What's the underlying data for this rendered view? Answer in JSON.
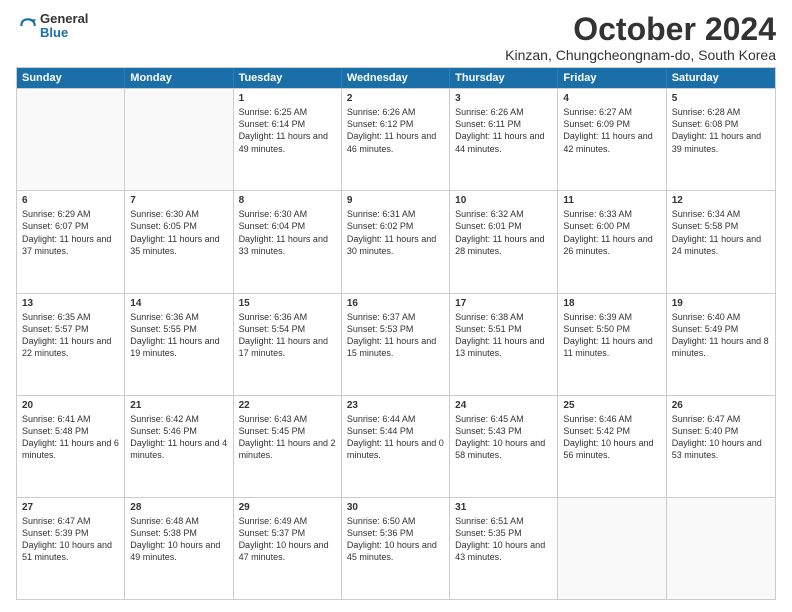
{
  "logo": {
    "general": "General",
    "blue": "Blue"
  },
  "title": "October 2024",
  "subtitle": "Kinzan, Chungcheongnam-do, South Korea",
  "days": [
    "Sunday",
    "Monday",
    "Tuesday",
    "Wednesday",
    "Thursday",
    "Friday",
    "Saturday"
  ],
  "weeks": [
    [
      {
        "day": "",
        "empty": true
      },
      {
        "day": "",
        "empty": true
      },
      {
        "day": "1",
        "sunrise": "Sunrise: 6:25 AM",
        "sunset": "Sunset: 6:14 PM",
        "daylight": "Daylight: 11 hours and 49 minutes."
      },
      {
        "day": "2",
        "sunrise": "Sunrise: 6:26 AM",
        "sunset": "Sunset: 6:12 PM",
        "daylight": "Daylight: 11 hours and 46 minutes."
      },
      {
        "day": "3",
        "sunrise": "Sunrise: 6:26 AM",
        "sunset": "Sunset: 6:11 PM",
        "daylight": "Daylight: 11 hours and 44 minutes."
      },
      {
        "day": "4",
        "sunrise": "Sunrise: 6:27 AM",
        "sunset": "Sunset: 6:09 PM",
        "daylight": "Daylight: 11 hours and 42 minutes."
      },
      {
        "day": "5",
        "sunrise": "Sunrise: 6:28 AM",
        "sunset": "Sunset: 6:08 PM",
        "daylight": "Daylight: 11 hours and 39 minutes."
      }
    ],
    [
      {
        "day": "6",
        "sunrise": "Sunrise: 6:29 AM",
        "sunset": "Sunset: 6:07 PM",
        "daylight": "Daylight: 11 hours and 37 minutes."
      },
      {
        "day": "7",
        "sunrise": "Sunrise: 6:30 AM",
        "sunset": "Sunset: 6:05 PM",
        "daylight": "Daylight: 11 hours and 35 minutes."
      },
      {
        "day": "8",
        "sunrise": "Sunrise: 6:30 AM",
        "sunset": "Sunset: 6:04 PM",
        "daylight": "Daylight: 11 hours and 33 minutes."
      },
      {
        "day": "9",
        "sunrise": "Sunrise: 6:31 AM",
        "sunset": "Sunset: 6:02 PM",
        "daylight": "Daylight: 11 hours and 30 minutes."
      },
      {
        "day": "10",
        "sunrise": "Sunrise: 6:32 AM",
        "sunset": "Sunset: 6:01 PM",
        "daylight": "Daylight: 11 hours and 28 minutes."
      },
      {
        "day": "11",
        "sunrise": "Sunrise: 6:33 AM",
        "sunset": "Sunset: 6:00 PM",
        "daylight": "Daylight: 11 hours and 26 minutes."
      },
      {
        "day": "12",
        "sunrise": "Sunrise: 6:34 AM",
        "sunset": "Sunset: 5:58 PM",
        "daylight": "Daylight: 11 hours and 24 minutes."
      }
    ],
    [
      {
        "day": "13",
        "sunrise": "Sunrise: 6:35 AM",
        "sunset": "Sunset: 5:57 PM",
        "daylight": "Daylight: 11 hours and 22 minutes."
      },
      {
        "day": "14",
        "sunrise": "Sunrise: 6:36 AM",
        "sunset": "Sunset: 5:55 PM",
        "daylight": "Daylight: 11 hours and 19 minutes."
      },
      {
        "day": "15",
        "sunrise": "Sunrise: 6:36 AM",
        "sunset": "Sunset: 5:54 PM",
        "daylight": "Daylight: 11 hours and 17 minutes."
      },
      {
        "day": "16",
        "sunrise": "Sunrise: 6:37 AM",
        "sunset": "Sunset: 5:53 PM",
        "daylight": "Daylight: 11 hours and 15 minutes."
      },
      {
        "day": "17",
        "sunrise": "Sunrise: 6:38 AM",
        "sunset": "Sunset: 5:51 PM",
        "daylight": "Daylight: 11 hours and 13 minutes."
      },
      {
        "day": "18",
        "sunrise": "Sunrise: 6:39 AM",
        "sunset": "Sunset: 5:50 PM",
        "daylight": "Daylight: 11 hours and 11 minutes."
      },
      {
        "day": "19",
        "sunrise": "Sunrise: 6:40 AM",
        "sunset": "Sunset: 5:49 PM",
        "daylight": "Daylight: 11 hours and 8 minutes."
      }
    ],
    [
      {
        "day": "20",
        "sunrise": "Sunrise: 6:41 AM",
        "sunset": "Sunset: 5:48 PM",
        "daylight": "Daylight: 11 hours and 6 minutes."
      },
      {
        "day": "21",
        "sunrise": "Sunrise: 6:42 AM",
        "sunset": "Sunset: 5:46 PM",
        "daylight": "Daylight: 11 hours and 4 minutes."
      },
      {
        "day": "22",
        "sunrise": "Sunrise: 6:43 AM",
        "sunset": "Sunset: 5:45 PM",
        "daylight": "Daylight: 11 hours and 2 minutes."
      },
      {
        "day": "23",
        "sunrise": "Sunrise: 6:44 AM",
        "sunset": "Sunset: 5:44 PM",
        "daylight": "Daylight: 11 hours and 0 minutes."
      },
      {
        "day": "24",
        "sunrise": "Sunrise: 6:45 AM",
        "sunset": "Sunset: 5:43 PM",
        "daylight": "Daylight: 10 hours and 58 minutes."
      },
      {
        "day": "25",
        "sunrise": "Sunrise: 6:46 AM",
        "sunset": "Sunset: 5:42 PM",
        "daylight": "Daylight: 10 hours and 56 minutes."
      },
      {
        "day": "26",
        "sunrise": "Sunrise: 6:47 AM",
        "sunset": "Sunset: 5:40 PM",
        "daylight": "Daylight: 10 hours and 53 minutes."
      }
    ],
    [
      {
        "day": "27",
        "sunrise": "Sunrise: 6:47 AM",
        "sunset": "Sunset: 5:39 PM",
        "daylight": "Daylight: 10 hours and 51 minutes."
      },
      {
        "day": "28",
        "sunrise": "Sunrise: 6:48 AM",
        "sunset": "Sunset: 5:38 PM",
        "daylight": "Daylight: 10 hours and 49 minutes."
      },
      {
        "day": "29",
        "sunrise": "Sunrise: 6:49 AM",
        "sunset": "Sunset: 5:37 PM",
        "daylight": "Daylight: 10 hours and 47 minutes."
      },
      {
        "day": "30",
        "sunrise": "Sunrise: 6:50 AM",
        "sunset": "Sunset: 5:36 PM",
        "daylight": "Daylight: 10 hours and 45 minutes."
      },
      {
        "day": "31",
        "sunrise": "Sunrise: 6:51 AM",
        "sunset": "Sunset: 5:35 PM",
        "daylight": "Daylight: 10 hours and 43 minutes."
      },
      {
        "day": "",
        "empty": true
      },
      {
        "day": "",
        "empty": true
      }
    ]
  ]
}
